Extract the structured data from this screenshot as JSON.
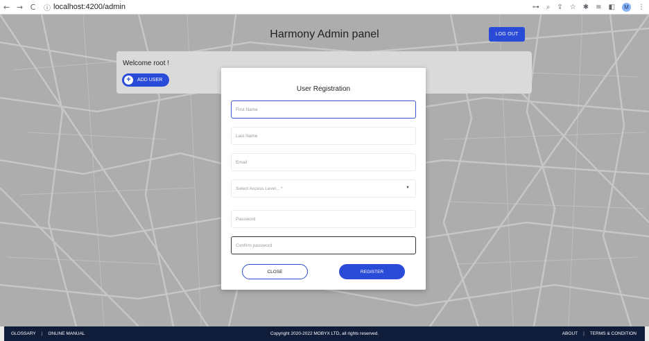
{
  "browser": {
    "back_icon": "←",
    "forward_icon": "→",
    "reload_icon": "C",
    "info_icon": "ⓘ",
    "url": "localhost:4200/admin",
    "key_icon": "⊶",
    "zoom_icon": "⌕",
    "share_icon": "⇪",
    "star_icon": "☆",
    "extensions_icon": "✱",
    "readinglist_icon": "≡",
    "sidepanel_icon": "◧",
    "profile_initial": "M",
    "menu_icon": "⋮"
  },
  "header": {
    "title": "Harmony Admin panel",
    "logout_label": "LOG OUT"
  },
  "welcome": {
    "text": "Welcome root !",
    "add_user_icon": "+",
    "add_user_label": "ADD USER"
  },
  "modal": {
    "title": "User Registration",
    "fields": {
      "first_name": "First Name",
      "last_name": "Last Name",
      "email": "Email",
      "access_level": "Select Access Level... *",
      "password": "Password",
      "confirm_password": "Confirm password"
    },
    "select_arrow": "▼",
    "close_label": "CLOSE",
    "register_label": "REGISTER"
  },
  "footer": {
    "glossary": "GLOSSARY",
    "separator": "|",
    "online_manual": "ONLINE MANUAL",
    "copyright": "Copyright 2020-2022 MOBYX LTD, all rights reserved.",
    "about": "ABOUT",
    "terms": "TERMS & CONDITION"
  },
  "colors": {
    "accent": "#2a4bd7",
    "footer_bg": "#101d3a"
  }
}
